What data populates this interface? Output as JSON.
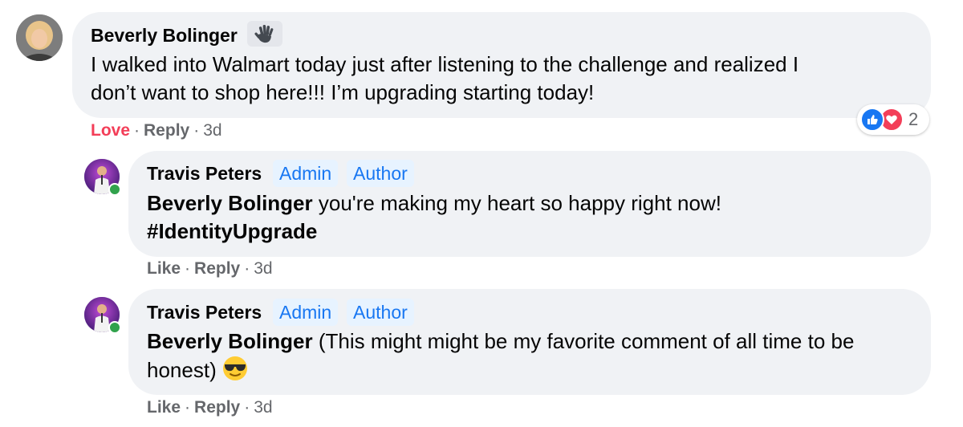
{
  "comment": {
    "author": "Beverly Bolinger",
    "badge_icon": "waving-hand-icon",
    "text_line1": "I walked into Walmart today just after listening to the challenge and realized I",
    "text_line2": "don’t want to shop here!!! I’m upgrading starting today!",
    "reaction": "Love",
    "reply": "Reply",
    "sep": "·",
    "time": "3d",
    "reactions": {
      "icons": [
        "like-reaction-icon",
        "love-reaction-icon"
      ],
      "count": "2"
    }
  },
  "replies": [
    {
      "author": "Travis Peters",
      "badges": [
        "Admin",
        "Author"
      ],
      "mention": "Beverly Bolinger",
      "text_line1_rest": " you're making my heart so happy right now!",
      "text_line2": "#IdentityUpgrade",
      "like": "Like",
      "reply": "Reply",
      "sep": "·",
      "time": "3d"
    },
    {
      "author": "Travis Peters",
      "badges": [
        "Admin",
        "Author"
      ],
      "mention": "Beverly Bolinger",
      "text_line1_rest": " (This might might be my favorite comment of all time to be",
      "text_line2": "honest)",
      "emoji": "sunglasses-emoji",
      "like": "Like",
      "reply": "Reply",
      "sep": "·",
      "time": "3d"
    }
  ],
  "colors": {
    "bubble": "#f0f2f5",
    "badge_bg": "#e7f3ff",
    "badge_text": "#1877f2",
    "love": "#f33e58",
    "meta": "#65676b",
    "online": "#31a24c"
  }
}
